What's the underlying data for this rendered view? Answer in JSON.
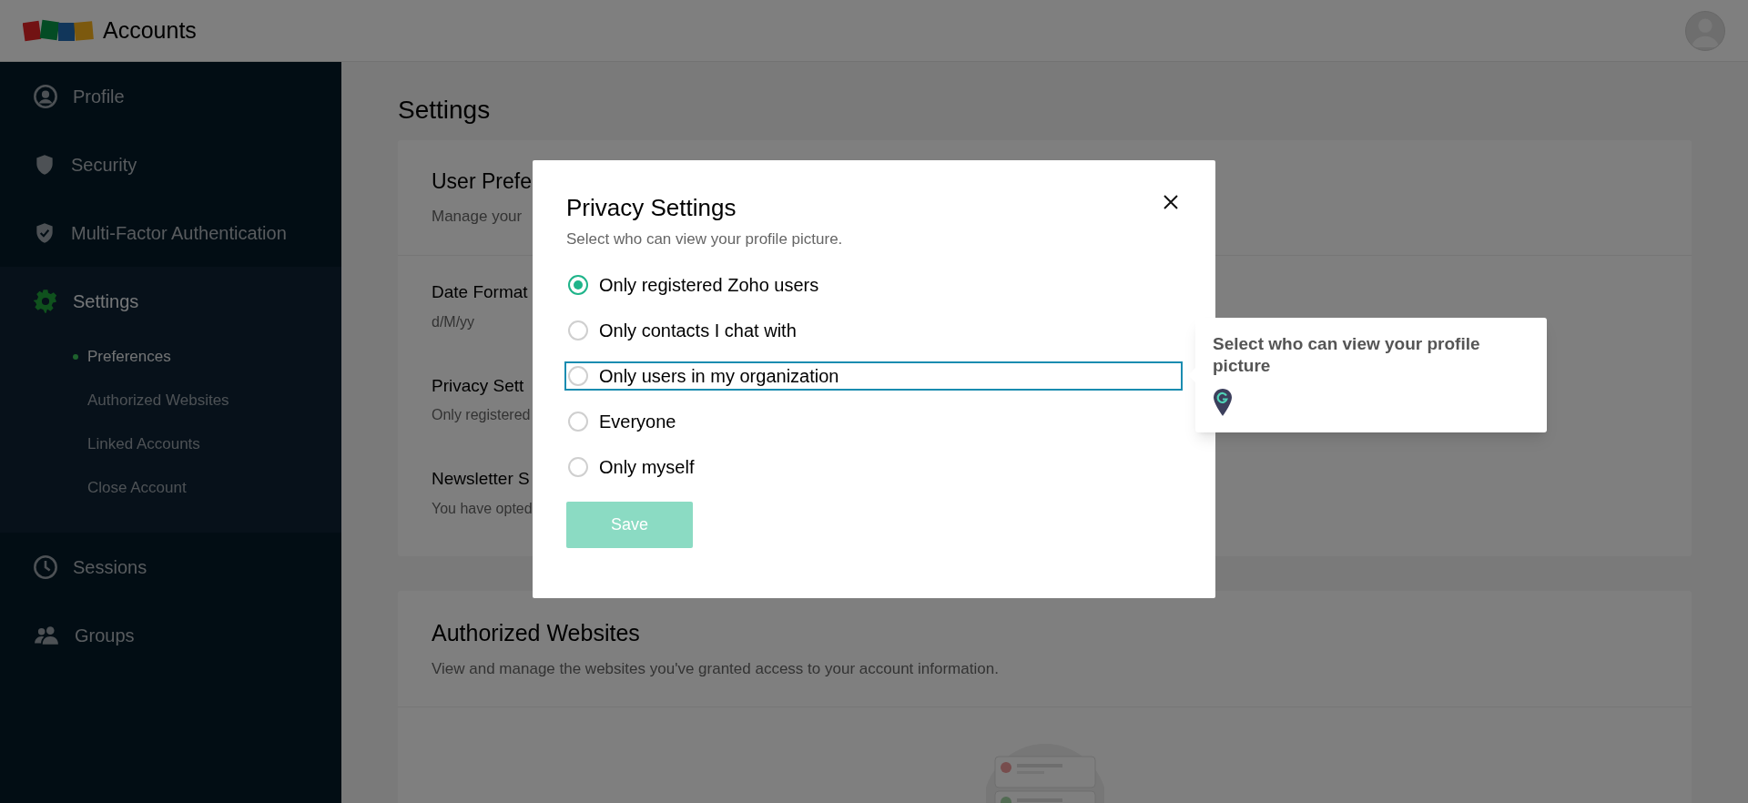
{
  "header": {
    "brand": "Accounts"
  },
  "sidebar": {
    "items": [
      {
        "label": "Profile",
        "selected": false
      },
      {
        "label": "Security",
        "selected": false
      },
      {
        "label": "Multi-Factor Authentication",
        "selected": false
      },
      {
        "label": "Settings",
        "selected": true,
        "expanded": true,
        "children": [
          {
            "label": "Preferences",
            "selected": true
          },
          {
            "label": "Authorized Websites",
            "selected": false
          },
          {
            "label": "Linked Accounts",
            "selected": false
          },
          {
            "label": "Close Account",
            "selected": false
          }
        ]
      },
      {
        "label": "Sessions",
        "selected": false
      },
      {
        "label": "Groups",
        "selected": false
      }
    ]
  },
  "page_title": "Settings",
  "preferences_card": {
    "title": "User Prefe",
    "subtitle": "Manage your",
    "rows": [
      {
        "label": "Date Format",
        "value": "d/M/yy"
      },
      {
        "label": "Privacy Sett",
        "value": "Only registered"
      },
      {
        "label": "Newsletter S",
        "value": "You have opted"
      }
    ]
  },
  "authorized_card": {
    "title": "Authorized Websites",
    "subtitle": "View and manage the websites you've granted access to your account information."
  },
  "dialog": {
    "title": "Privacy Settings",
    "subtitle": "Select who can view your profile picture.",
    "options": [
      {
        "label": "Only registered Zoho users",
        "selected": true,
        "focused": false
      },
      {
        "label": "Only contacts I chat with",
        "selected": false,
        "focused": false
      },
      {
        "label": "Only users in my organization",
        "selected": false,
        "focused": true
      },
      {
        "label": "Everyone",
        "selected": false,
        "focused": false
      },
      {
        "label": "Only myself",
        "selected": false,
        "focused": false
      }
    ],
    "save_button": {
      "label": "Save",
      "disabled": true
    }
  },
  "tooltip": {
    "text": "Select who can view your profile picture"
  }
}
